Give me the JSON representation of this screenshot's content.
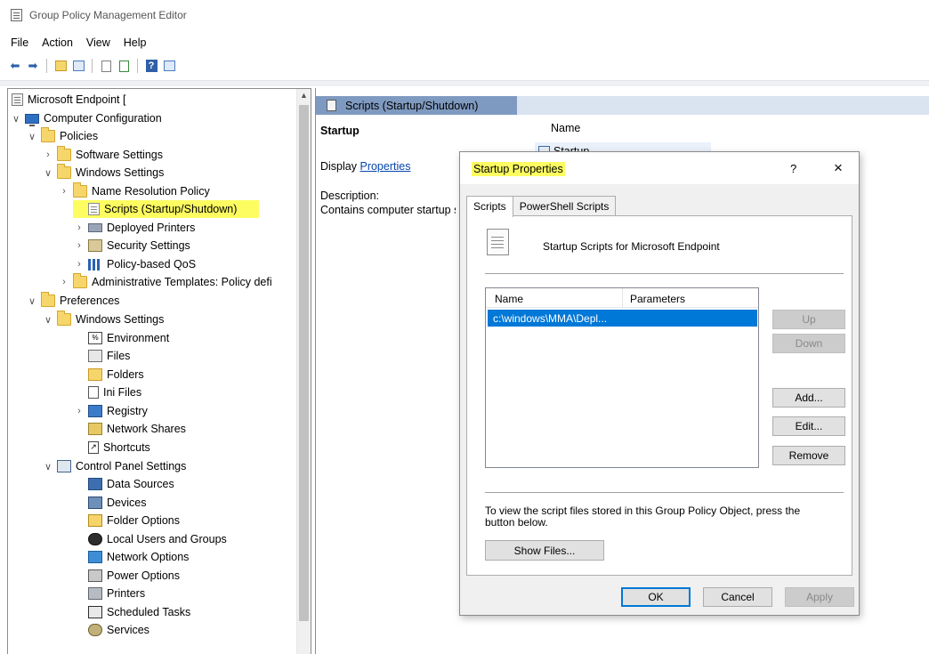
{
  "window": {
    "title": "Group Policy Management Editor"
  },
  "menu": [
    "File",
    "Action",
    "View",
    "Help"
  ],
  "toolbar": {
    "icons": [
      "back-arrow-icon",
      "forward-arrow-icon",
      "up-folder-icon",
      "show-hide-tree-icon",
      "properties-icon",
      "export-list-icon",
      "help-icon",
      "view-icon"
    ]
  },
  "tree": {
    "root": "Microsoft Endpoint [",
    "items": [
      {
        "label": "Computer Configuration"
      },
      {
        "label": "Policies"
      },
      {
        "label": "Software Settings"
      },
      {
        "label": "Windows Settings"
      },
      {
        "label": "Name Resolution Policy"
      },
      {
        "label": "Scripts (Startup/Shutdown)"
      },
      {
        "label": "Deployed Printers"
      },
      {
        "label": "Security Settings"
      },
      {
        "label": "Policy-based QoS"
      },
      {
        "label": "Administrative Templates: Policy defi"
      },
      {
        "label": "Preferences"
      },
      {
        "label": "Windows Settings"
      },
      {
        "label": "Environment"
      },
      {
        "label": "Files"
      },
      {
        "label": "Folders"
      },
      {
        "label": "Ini Files"
      },
      {
        "label": "Registry"
      },
      {
        "label": "Network Shares"
      },
      {
        "label": "Shortcuts"
      },
      {
        "label": "Control Panel Settings"
      },
      {
        "label": "Data Sources"
      },
      {
        "label": "Devices"
      },
      {
        "label": "Folder Options"
      },
      {
        "label": "Local Users and Groups"
      },
      {
        "label": "Network Options"
      },
      {
        "label": "Power Options"
      },
      {
        "label": "Printers"
      },
      {
        "label": "Scheduled Tasks"
      },
      {
        "label": "Services"
      }
    ]
  },
  "details": {
    "header": "Scripts (Startup/Shutdown)",
    "section_title": "Startup",
    "display_prefix": "Display",
    "display_link": "Properties",
    "description_label": "Description:",
    "description_text": "Contains computer startup scripts.",
    "column_name": "Name",
    "item": "Startup"
  },
  "dialog": {
    "title": "Startup Properties",
    "help": "?",
    "close": "×",
    "tabs": [
      "Scripts",
      "PowerShell Scripts"
    ],
    "heading": "Startup Scripts for Microsoft Endpoint",
    "list": {
      "columns": [
        "Name",
        "Parameters"
      ],
      "rows": [
        {
          "name": "c:\\windows\\MMA\\Depl...",
          "parameters": ""
        }
      ]
    },
    "buttons": {
      "up": "Up",
      "down": "Down",
      "add": "Add...",
      "edit": "Edit...",
      "remove": "Remove"
    },
    "info": "To view the script files stored in this Group Policy Object, press the button below.",
    "show_files": "Show Files...",
    "ok": "OK",
    "cancel": "Cancel",
    "apply": "Apply"
  },
  "colors": {
    "highlight": "#fdfd61",
    "selection": "#0078d7",
    "header_band": "#7f9ac0"
  }
}
